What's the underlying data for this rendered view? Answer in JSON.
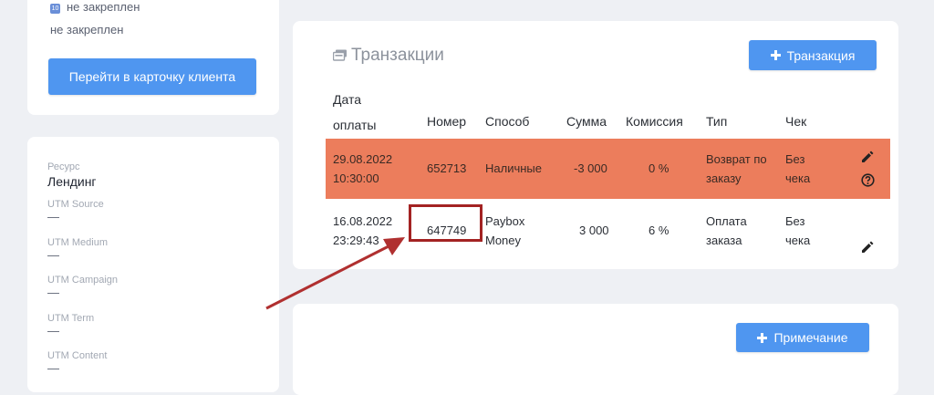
{
  "client_card": {
    "pinned_label_1": "не закреплен",
    "pinned_label_2": "не закреплен",
    "go_to_client_button": "Перейти в карточку клиента"
  },
  "utm_card": {
    "resource_label": "Ресурс",
    "resource_value": "Лендинг",
    "fields": [
      {
        "label": "UTM Source",
        "value": "—"
      },
      {
        "label": "UTM Medium",
        "value": "—"
      },
      {
        "label": "UTM Campaign",
        "value": "—"
      },
      {
        "label": "UTM Term",
        "value": "—"
      },
      {
        "label": "UTM Content",
        "value": "—"
      }
    ]
  },
  "transactions": {
    "title": "Транзакции",
    "add_button": "Транзакция",
    "headers": {
      "date_line1": "Дата",
      "date_line2": "оплаты",
      "number": "Номер",
      "method": "Способ",
      "amount": "Сумма",
      "commission": "Комиссия",
      "type": "Тип",
      "receipt": "Чек"
    },
    "rows": [
      {
        "date": "29.08.2022",
        "time": "10:30:00",
        "number": "652713",
        "method_1": "Наличные",
        "method_2": "",
        "amount": "-3 000",
        "commission": "0 %",
        "type_1": "Возврат по",
        "type_2": "заказу",
        "receipt_1": "Без",
        "receipt_2": "чека",
        "bg": "#ec7d5c"
      },
      {
        "date": "16.08.2022",
        "time": "23:29:43",
        "number": "647749",
        "method_1": "Paybox",
        "method_2": "Money",
        "amount": "3 000",
        "commission": "6 %",
        "type_1": "Оплата",
        "type_2": "заказа",
        "receipt_1": "Без",
        "receipt_2": "чека",
        "bg": "#ffffff"
      }
    ]
  },
  "notes": {
    "add_button": "Примечание"
  },
  "colors": {
    "accent": "#4f96f0",
    "refund_row": "#ec7d5c",
    "highlight": "#a32323",
    "background": "#eef0f4"
  },
  "icons": [
    "pin-badge-icon",
    "transactions-icon",
    "plus-icon",
    "edit-icon",
    "help-icon",
    "annotation-arrow"
  ]
}
